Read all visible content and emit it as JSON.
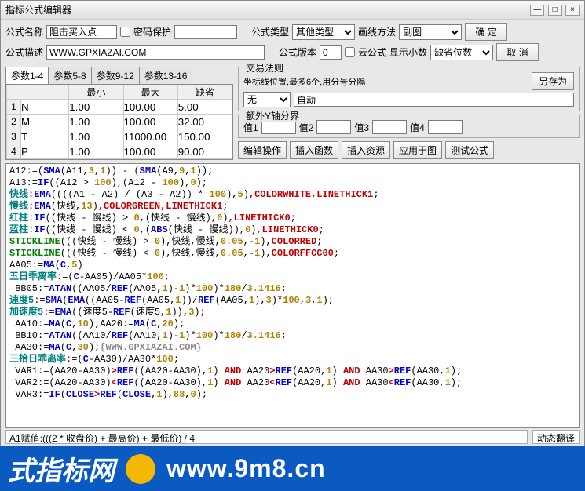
{
  "window": {
    "title": "指标公式编辑器"
  },
  "labels": {
    "name": "公式名称",
    "pwd": "密码保护",
    "type": "公式类型",
    "draw": "画线方法",
    "desc": "公式描述",
    "ver": "公式版本",
    "cloud": "云公式",
    "dec": "显示小数",
    "def": "缺省位数",
    "rule": "交易法则",
    "ruleHint": "坐标线位置,最多6个,用分号分隔",
    "extra": "额外Y轴分界",
    "v1": "值1",
    "v2": "值2",
    "v3": "值3",
    "v4": "值4"
  },
  "buttons": {
    "ok": "确  定",
    "cancel": "取  消",
    "saveas": "另存为",
    "editop": "编辑操作",
    "insfn": "插入函数",
    "insres": "插入资源",
    "apply": "应用于图",
    "test": "测试公式"
  },
  "fields": {
    "name": "阻击买入点",
    "desc": "WWW.GPXIAZAI.COM",
    "ver": "0",
    "type": "其他类型",
    "draw": "副图",
    "dec": "缺省位数",
    "rule": "无",
    "ruleR": "自动"
  },
  "tabs": [
    "参数1-4",
    "参数5-8",
    "参数9-12",
    "参数13-16"
  ],
  "paramHead": [
    "",
    "最小",
    "最大",
    "缺省"
  ],
  "params": [
    {
      "n": "1",
      "name": "N",
      "min": "1.00",
      "max": "100.00",
      "def": "5.00"
    },
    {
      "n": "2",
      "name": "M",
      "min": "1.00",
      "max": "100.00",
      "def": "32.00"
    },
    {
      "n": "3",
      "name": "T",
      "min": "1.00",
      "max": "11000.00",
      "def": "150.00"
    },
    {
      "n": "4",
      "name": "P",
      "min": "1.00",
      "max": "100.00",
      "def": "90.00"
    }
  ],
  "status": {
    "left": "A1赋值:(((2 * 收盘价) + 最高价) + 最低价) / 4",
    "right": "动态翻译"
  },
  "banner": {
    "cn": "式指标网",
    "url": "www.9m8.cn"
  },
  "code": [
    [
      [
        "c-black",
        "A12:=("
      ],
      [
        "c-blue",
        "SMA"
      ],
      [
        "c-black",
        "(A11,"
      ],
      [
        "c-num",
        "3"
      ],
      [
        "c-black",
        ","
      ],
      [
        "c-num",
        "1"
      ],
      [
        "c-black",
        ")) - ("
      ],
      [
        "c-blue",
        "SMA"
      ],
      [
        "c-black",
        "(A9,"
      ],
      [
        "c-num",
        "9"
      ],
      [
        "c-black",
        ","
      ],
      [
        "c-num",
        "1"
      ],
      [
        "c-black",
        "));"
      ]
    ],
    [
      [
        "c-black",
        "A13:="
      ],
      [
        "c-blue",
        "IF"
      ],
      [
        "c-black",
        "((A12 > "
      ],
      [
        "c-num",
        "100"
      ],
      [
        "c-black",
        "),(A12 - "
      ],
      [
        "c-num",
        "100"
      ],
      [
        "c-black",
        "),"
      ],
      [
        "c-num",
        "0"
      ],
      [
        "c-black",
        ");"
      ]
    ],
    [
      [
        "c-teal",
        "快线"
      ],
      [
        "c-red",
        ":"
      ],
      [
        "c-blue",
        "EMA"
      ],
      [
        "c-black",
        "((((A1 - A2) / (A3 - A2)) * "
      ],
      [
        "c-num",
        "100"
      ],
      [
        "c-black",
        "),"
      ],
      [
        "c-num",
        "5"
      ],
      [
        "c-black",
        ")"
      ],
      [
        "c-red",
        ",COLORWHITE,LINETHICK1"
      ],
      [
        "c-black",
        ";"
      ]
    ],
    [
      [
        "c-teal",
        "慢线"
      ],
      [
        "c-red",
        ":"
      ],
      [
        "c-blue",
        "EMA"
      ],
      [
        "c-black",
        "(快线,"
      ],
      [
        "c-num",
        "13"
      ],
      [
        "c-black",
        ")"
      ],
      [
        "c-red",
        ",COLORGREEN,LINETHICK1"
      ],
      [
        "c-black",
        ";"
      ]
    ],
    [
      [
        "c-teal",
        "红柱"
      ],
      [
        "c-red",
        ":"
      ],
      [
        "c-blue",
        "IF"
      ],
      [
        "c-black",
        "((快线 - 慢线) > "
      ],
      [
        "c-num",
        "0"
      ],
      [
        "c-black",
        ",(快线 - 慢线),"
      ],
      [
        "c-num",
        "0"
      ],
      [
        "c-black",
        ")"
      ],
      [
        "c-red",
        ",LINETHICK0"
      ],
      [
        "c-black",
        ";"
      ]
    ],
    [
      [
        "c-teal",
        "蓝柱"
      ],
      [
        "c-red",
        ":"
      ],
      [
        "c-blue",
        "IF"
      ],
      [
        "c-black",
        "((快线 - 慢线) < "
      ],
      [
        "c-num",
        "0"
      ],
      [
        "c-black",
        ",("
      ],
      [
        "c-blue",
        "ABS"
      ],
      [
        "c-black",
        "(快线 - 慢线)),"
      ],
      [
        "c-num",
        "0"
      ],
      [
        "c-black",
        ")"
      ],
      [
        "c-red",
        ",LINETHICK0"
      ],
      [
        "c-black",
        ";"
      ]
    ],
    [
      [
        "c-green",
        "STICKLINE"
      ],
      [
        "c-black",
        "(((快线 - 慢线) > "
      ],
      [
        "c-num",
        "0"
      ],
      [
        "c-black",
        "),快线,慢线,"
      ],
      [
        "c-num",
        "0.05"
      ],
      [
        "c-black",
        ",-"
      ],
      [
        "c-num",
        "1"
      ],
      [
        "c-black",
        "),"
      ],
      [
        "c-red",
        "COLORRED"
      ],
      [
        "c-black",
        ";"
      ]
    ],
    [
      [
        "c-green",
        "STICKLINE"
      ],
      [
        "c-black",
        "(((快线 - 慢线) < "
      ],
      [
        "c-num",
        "0"
      ],
      [
        "c-black",
        "),快线,慢线,"
      ],
      [
        "c-num",
        "0.05"
      ],
      [
        "c-black",
        ",-"
      ],
      [
        "c-num",
        "1"
      ],
      [
        "c-black",
        "),"
      ],
      [
        "c-red",
        "COLORFFCC00"
      ],
      [
        "c-black",
        ";"
      ]
    ],
    [
      [
        "c-black",
        "AA05:="
      ],
      [
        "c-blue",
        "MA"
      ],
      [
        "c-black",
        "("
      ],
      [
        "c-blue",
        "C"
      ],
      [
        "c-black",
        ","
      ],
      [
        "c-num",
        "5"
      ],
      [
        "c-black",
        ")"
      ]
    ],
    [
      [
        "c-teal",
        "五日乖离率"
      ],
      [
        "c-red",
        ":"
      ],
      [
        "c-black",
        "=("
      ],
      [
        "c-blue",
        "C"
      ],
      [
        "c-black",
        "-AA05)/AA05*"
      ],
      [
        "c-num",
        "100"
      ],
      [
        "c-black",
        ";"
      ]
    ],
    [
      [
        "c-black",
        " BB05:="
      ],
      [
        "c-blue",
        "ATAN"
      ],
      [
        "c-black",
        "((AA05/"
      ],
      [
        "c-blue",
        "REF"
      ],
      [
        "c-black",
        "(AA05,"
      ],
      [
        "c-num",
        "1"
      ],
      [
        "c-black",
        ")-"
      ],
      [
        "c-num",
        "1"
      ],
      [
        "c-black",
        ")*"
      ],
      [
        "c-num",
        "100"
      ],
      [
        "c-black",
        ")*"
      ],
      [
        "c-num",
        "180"
      ],
      [
        "c-black",
        "/"
      ],
      [
        "c-num",
        "3.1416"
      ],
      [
        "c-black",
        ";"
      ]
    ],
    [
      [
        "c-teal",
        "速度5"
      ],
      [
        "c-red",
        ":"
      ],
      [
        "c-black",
        "="
      ],
      [
        "c-blue",
        "SMA"
      ],
      [
        "c-black",
        "("
      ],
      [
        "c-blue",
        "EMA"
      ],
      [
        "c-black",
        "((AA05-"
      ],
      [
        "c-blue",
        "REF"
      ],
      [
        "c-black",
        "(AA05,"
      ],
      [
        "c-num",
        "1"
      ],
      [
        "c-black",
        "))/"
      ],
      [
        "c-blue",
        "REF"
      ],
      [
        "c-black",
        "(AA05,"
      ],
      [
        "c-num",
        "1"
      ],
      [
        "c-black",
        "),"
      ],
      [
        "c-num",
        "3"
      ],
      [
        "c-black",
        ")*"
      ],
      [
        "c-num",
        "100"
      ],
      [
        "c-black",
        ","
      ],
      [
        "c-num",
        "3"
      ],
      [
        "c-black",
        ","
      ],
      [
        "c-num",
        "1"
      ],
      [
        "c-black",
        ");"
      ]
    ],
    [
      [
        "c-teal",
        "加速度5"
      ],
      [
        "c-red",
        ":"
      ],
      [
        "c-black",
        "="
      ],
      [
        "c-blue",
        "EMA"
      ],
      [
        "c-black",
        "((速度5-"
      ],
      [
        "c-blue",
        "REF"
      ],
      [
        "c-black",
        "(速度5,"
      ],
      [
        "c-num",
        "1"
      ],
      [
        "c-black",
        ")),"
      ],
      [
        "c-num",
        "3"
      ],
      [
        "c-black",
        ");"
      ]
    ],
    [
      [
        "c-black",
        " AA10:="
      ],
      [
        "c-blue",
        "MA"
      ],
      [
        "c-black",
        "("
      ],
      [
        "c-blue",
        "C"
      ],
      [
        "c-black",
        ","
      ],
      [
        "c-num",
        "10"
      ],
      [
        "c-black",
        ");AA20:="
      ],
      [
        "c-blue",
        "MA"
      ],
      [
        "c-black",
        "("
      ],
      [
        "c-blue",
        "C"
      ],
      [
        "c-black",
        ","
      ],
      [
        "c-num",
        "20"
      ],
      [
        "c-black",
        ");"
      ]
    ],
    [
      [
        "c-black",
        " BB10:="
      ],
      [
        "c-blue",
        "ATAN"
      ],
      [
        "c-black",
        "((AA10/"
      ],
      [
        "c-blue",
        "REF"
      ],
      [
        "c-black",
        "(AA10,"
      ],
      [
        "c-num",
        "1"
      ],
      [
        "c-black",
        ")-"
      ],
      [
        "c-num",
        "1"
      ],
      [
        "c-black",
        ")*"
      ],
      [
        "c-num",
        "100"
      ],
      [
        "c-black",
        ")*"
      ],
      [
        "c-num",
        "180"
      ],
      [
        "c-black",
        "/"
      ],
      [
        "c-num",
        "3.1416"
      ],
      [
        "c-black",
        ";"
      ]
    ],
    [
      [
        "c-black",
        " AA30:="
      ],
      [
        "c-blue",
        "MA"
      ],
      [
        "c-black",
        "("
      ],
      [
        "c-blue",
        "C"
      ],
      [
        "c-black",
        ","
      ],
      [
        "c-num",
        "30"
      ],
      [
        "c-black",
        ");"
      ],
      [
        "c-gray",
        "{WWW.GPXIAZAI.COM}"
      ]
    ],
    [
      [
        "c-teal",
        "三拾日乖离率"
      ],
      [
        "c-red",
        ":"
      ],
      [
        "c-black",
        "=("
      ],
      [
        "c-blue",
        "C"
      ],
      [
        "c-black",
        "-AA30)/AA30*"
      ],
      [
        "c-num",
        "100"
      ],
      [
        "c-black",
        ";"
      ]
    ],
    [
      [
        "c-black",
        " VAR1:=(AA20-AA30)"
      ],
      [
        "c-red",
        ">"
      ],
      [
        "c-blue",
        "REF"
      ],
      [
        "c-black",
        "((AA20-AA30),"
      ],
      [
        "c-num",
        "1"
      ],
      [
        "c-black",
        ") "
      ],
      [
        "c-red",
        "AND"
      ],
      [
        "c-black",
        " AA20"
      ],
      [
        "c-red",
        ">"
      ],
      [
        "c-blue",
        "REF"
      ],
      [
        "c-black",
        "(AA20,"
      ],
      [
        "c-num",
        "1"
      ],
      [
        "c-black",
        ") "
      ],
      [
        "c-red",
        "AND"
      ],
      [
        "c-black",
        " AA30"
      ],
      [
        "c-red",
        ">"
      ],
      [
        "c-blue",
        "REF"
      ],
      [
        "c-black",
        "(AA30,"
      ],
      [
        "c-num",
        "1"
      ],
      [
        "c-black",
        ");"
      ]
    ],
    [
      [
        "c-black",
        " VAR2:=(AA20-AA30)"
      ],
      [
        "c-red",
        "<"
      ],
      [
        "c-blue",
        "REF"
      ],
      [
        "c-black",
        "((AA20-AA30),"
      ],
      [
        "c-num",
        "1"
      ],
      [
        "c-black",
        ") "
      ],
      [
        "c-red",
        "AND"
      ],
      [
        "c-black",
        " AA20"
      ],
      [
        "c-red",
        "<"
      ],
      [
        "c-blue",
        "REF"
      ],
      [
        "c-black",
        "(AA20,"
      ],
      [
        "c-num",
        "1"
      ],
      [
        "c-black",
        ") "
      ],
      [
        "c-red",
        "AND"
      ],
      [
        "c-black",
        " AA30"
      ],
      [
        "c-red",
        "<"
      ],
      [
        "c-blue",
        "REF"
      ],
      [
        "c-black",
        "(AA30,"
      ],
      [
        "c-num",
        "1"
      ],
      [
        "c-black",
        ");"
      ]
    ],
    [
      [
        "c-black",
        " VAR3:="
      ],
      [
        "c-blue",
        "IF"
      ],
      [
        "c-black",
        "("
      ],
      [
        "c-blue",
        "CLOSE"
      ],
      [
        "c-red",
        ">"
      ],
      [
        "c-blue",
        "REF"
      ],
      [
        "c-black",
        "("
      ],
      [
        "c-blue",
        "CLOSE"
      ],
      [
        "c-black",
        ","
      ],
      [
        "c-num",
        "1"
      ],
      [
        "c-black",
        "),"
      ],
      [
        "c-num",
        "88"
      ],
      [
        "c-black",
        ","
      ],
      [
        "c-num",
        "0"
      ],
      [
        "c-black",
        ");"
      ]
    ]
  ]
}
